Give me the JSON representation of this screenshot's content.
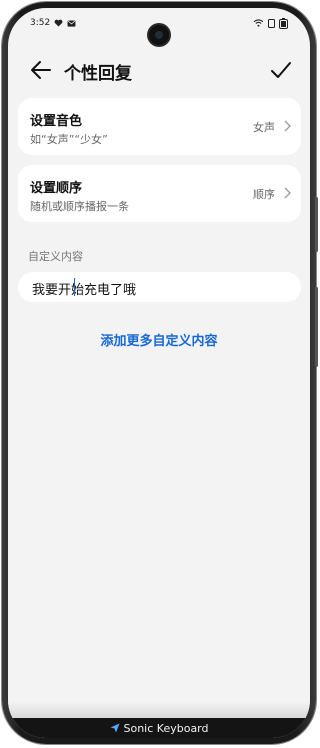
{
  "status": {
    "time": "3:52",
    "heart_icon": "heart-icon",
    "mail_icon": "mail-icon"
  },
  "header": {
    "title": "个性回复"
  },
  "cards": [
    {
      "label": "设置音色",
      "sub": "如“女声”“少女”",
      "value": "女声"
    },
    {
      "label": "设置顺序",
      "sub": "随机或顺序播报一条",
      "value": "顺序"
    }
  ],
  "custom": {
    "section_label": "自定义内容",
    "input_value": "我要开始充电了哦",
    "add_more": "添加更多自定义内容"
  },
  "keyboard": {
    "name": "Sonic Keyboard"
  },
  "colors": {
    "accent": "#1668d6",
    "background": "#f3f3f3"
  }
}
